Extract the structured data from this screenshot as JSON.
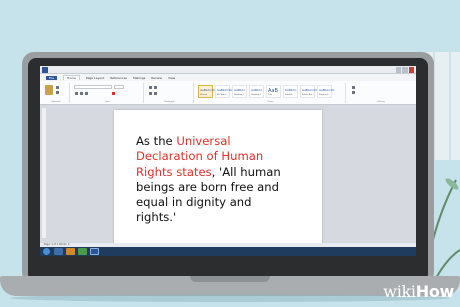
{
  "word": {
    "tabs": [
      "File",
      "Home",
      "Page Layout",
      "References",
      "Mailings",
      "Review",
      "View"
    ],
    "active_tab": "Home",
    "styles": [
      {
        "sample": "AaBbCcDc",
        "name": "Normal"
      },
      {
        "sample": "AaBbCcDc",
        "name": "No Spaci..."
      },
      {
        "sample": "AaBbCc",
        "name": "Heading 1"
      },
      {
        "sample": "AaBbCc",
        "name": "Heading 2"
      },
      {
        "sample": "AaB",
        "name": "Title"
      },
      {
        "sample": "AaBbCc",
        "name": "Subtitle"
      },
      {
        "sample": "AaBbCcDc",
        "name": "Subtle Em..."
      },
      {
        "sample": "AaBbCcDc",
        "name": "Emphasis"
      }
    ],
    "group_labels": {
      "clipboard": "Clipboard",
      "font": "Font",
      "paragraph": "Paragraph",
      "styles": "Styles",
      "editing": "Editing"
    },
    "status": "Page: 1 of 1   Words: 0"
  },
  "document": {
    "line1_prefix": "As the ",
    "line1_highlight": "Universal",
    "line2_highlight": "Declaration of Human",
    "line3_highlight": "Rights states",
    "line3_rest": ", 'All human",
    "line4": "beings are born free and",
    "line5": "equal in dignity and",
    "line6": "rights.'"
  },
  "watermark": {
    "part1": "wiki",
    "part2": "How"
  },
  "colors": {
    "highlight": "#e1302a",
    "ribbon_accent": "#2b579a"
  }
}
